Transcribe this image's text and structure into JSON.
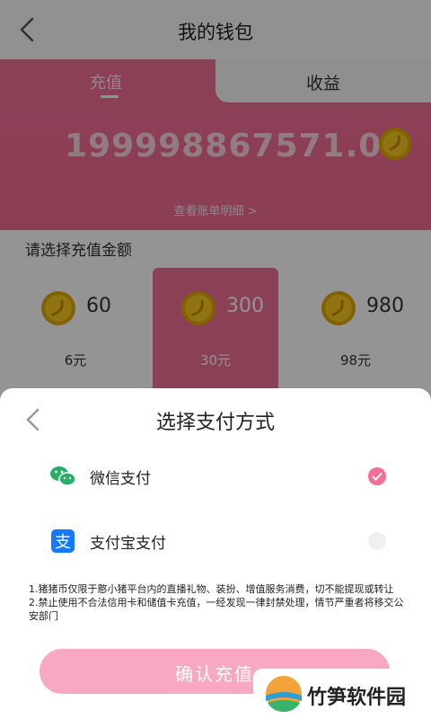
{
  "nav": {
    "title": "我的钱包"
  },
  "tabs": {
    "recharge_label": "充值",
    "income_label": "收益"
  },
  "wallet": {
    "balance": "19999886757​1.00",
    "detail_link": "查看账单明细 >"
  },
  "recharge": {
    "prompt": "请选择充值金额",
    "options": [
      {
        "coins": "60",
        "price": "6元"
      },
      {
        "coins": "300",
        "price": "30元"
      },
      {
        "coins": "980",
        "price": "98元"
      }
    ]
  },
  "payment": {
    "title": "选择支付方式",
    "methods": [
      {
        "label": "微信支付",
        "selected": true
      },
      {
        "label": "支付宝支付",
        "selected": false
      }
    ],
    "note1": "1.猪猪币仅限于憨小猪平台内的直播礼物、装扮、增值服务消费，切不能提现或转让",
    "note2": "2.禁止使用不合法信用卡和储值卡充值，一经发现一律封禁处理，情节严重者将移交公安部门",
    "confirm_label": "确认充值"
  },
  "watermark": {
    "text": "竹笋软件园"
  },
  "colors": {
    "accent": "#f26f95",
    "confirm": "#f8a8c0",
    "wechat": "#2aae67",
    "alipay": "#1677ff"
  },
  "icons": {
    "back": "chevron-left-icon",
    "coin": "coin-icon",
    "wechat": "wechat-icon",
    "alipay": "alipay-icon"
  }
}
